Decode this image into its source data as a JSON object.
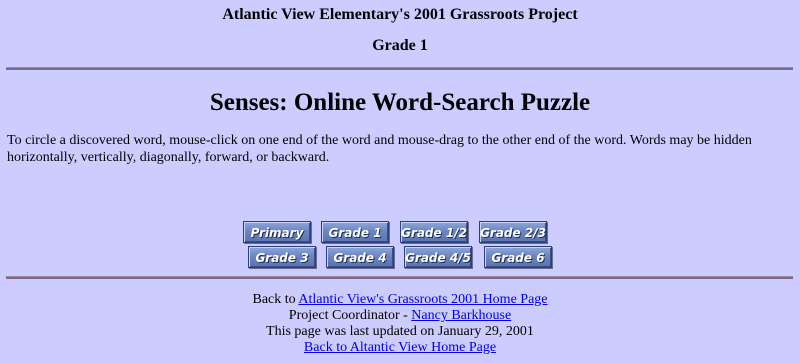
{
  "header": {
    "school_title": "Atlantic View Elementary's 2001 Grassroots Project",
    "grade": "Grade 1"
  },
  "main": {
    "title": "Senses: Online Word-Search Puzzle",
    "instructions": "To circle a discovered word, mouse-click on one end of the word and mouse-drag to the other end of the word. Words may be hidden horizontally, vertically, diagonally, forward, or backward."
  },
  "grade_nav": {
    "buttons": [
      {
        "label": "Primary"
      },
      {
        "label": "Grade 1"
      },
      {
        "label": "Grade 1/2"
      },
      {
        "label": "Grade 2/3"
      },
      {
        "label": "Grade 3"
      },
      {
        "label": "Grade 4"
      },
      {
        "label": "Grade 4/5"
      },
      {
        "label": "Grade 6"
      }
    ]
  },
  "footer": {
    "back_prefix": "Back to ",
    "home_link": "Atlantic View's Grassroots 2001 Home Page",
    "coordinator_prefix": "Project Coordinator - ",
    "coordinator_name": "Nancy Barkhouse",
    "updated": "This page was last updated on January 29, 2001",
    "school_home_link": "Back to Altantic View Home Page"
  },
  "colors": {
    "background": "#ccccff",
    "rule": "#7a6a86",
    "link": "#0000ee",
    "button": "#6d86c2"
  }
}
